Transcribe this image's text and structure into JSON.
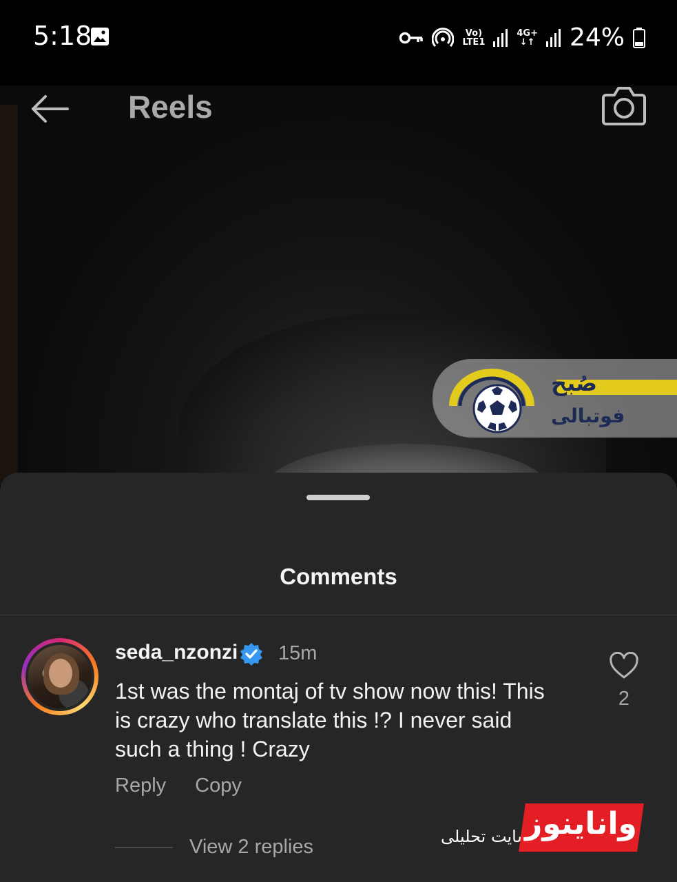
{
  "status_bar": {
    "time": "5:18",
    "net1_top": "Vo)",
    "net1_bottom": "LTE1",
    "net2_top": "4G+",
    "net2_bottom": "↓↑",
    "battery": "24%",
    "icons": [
      "image-icon",
      "key-icon",
      "hotspot-icon",
      "signal-icon",
      "battery-icon"
    ]
  },
  "header": {
    "title": "Reels",
    "icons": [
      "back-arrow-icon",
      "camera-icon"
    ]
  },
  "video": {
    "logo_line1": "صُبح",
    "logo_line2": "فوتبالی",
    "logo_colors": {
      "yellow": "#e3cb1e",
      "navy": "#1d2a55"
    }
  },
  "comments_sheet": {
    "title": "Comments",
    "comment": {
      "username": "seda_nzonzi",
      "verified": true,
      "time": "15m",
      "text": "1st was the montaj of tv show now this! This is crazy who translate this !? I never said such a thing ! Crazy",
      "reply_label": "Reply",
      "copy_label": "Copy",
      "likes": "2",
      "view_replies": "View 2 replies"
    }
  },
  "watermark": {
    "brand": "واناینوز",
    "subtitle": "سایت تحلیلی",
    "color": "#e31e24"
  }
}
